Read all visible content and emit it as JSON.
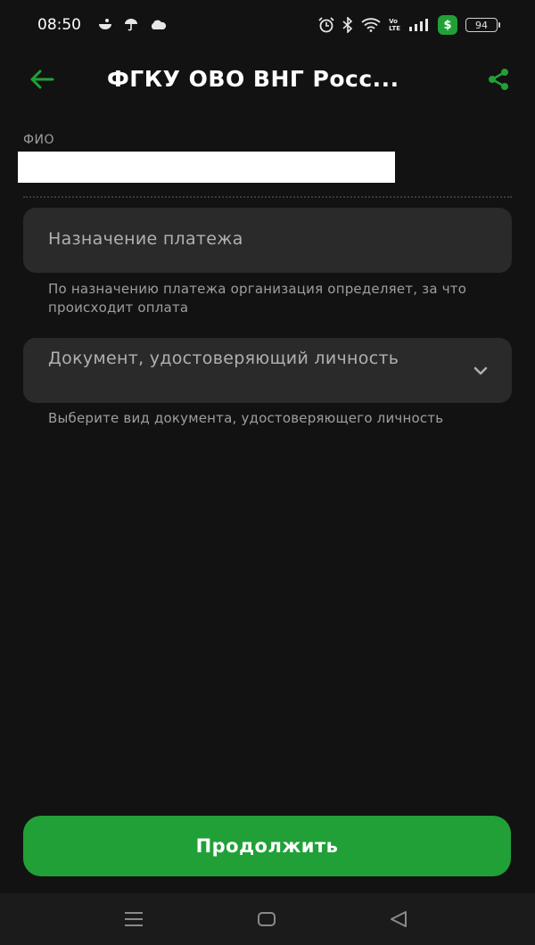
{
  "status_bar": {
    "time": "08:50",
    "battery": "94",
    "badge": "$",
    "volte_top": "Vo",
    "volte_bottom": "LTE"
  },
  "header": {
    "title": "ФГКУ ОВО ВНГ Росс..."
  },
  "form": {
    "fio_label": "ФИО",
    "fio_value": "",
    "purpose_placeholder": "Назначение платежа",
    "purpose_hint": "По назначению платежа организация определяет, за что происходит оплата",
    "document_placeholder": "Документ, удостоверяющий личность",
    "document_hint": "Выберите вид документа, удостоверяющего личность"
  },
  "actions": {
    "continue_label": "Продолжить"
  },
  "colors": {
    "accent": "#21a038",
    "background": "#121212",
    "field": "#2a2a2a"
  },
  "icons": {
    "back": "arrow-left-icon",
    "share": "share-icon",
    "chevron": "chevron-down-icon",
    "nav_menu": "menu-icon",
    "nav_home": "home-icon",
    "nav_back": "back-triangle-icon"
  }
}
